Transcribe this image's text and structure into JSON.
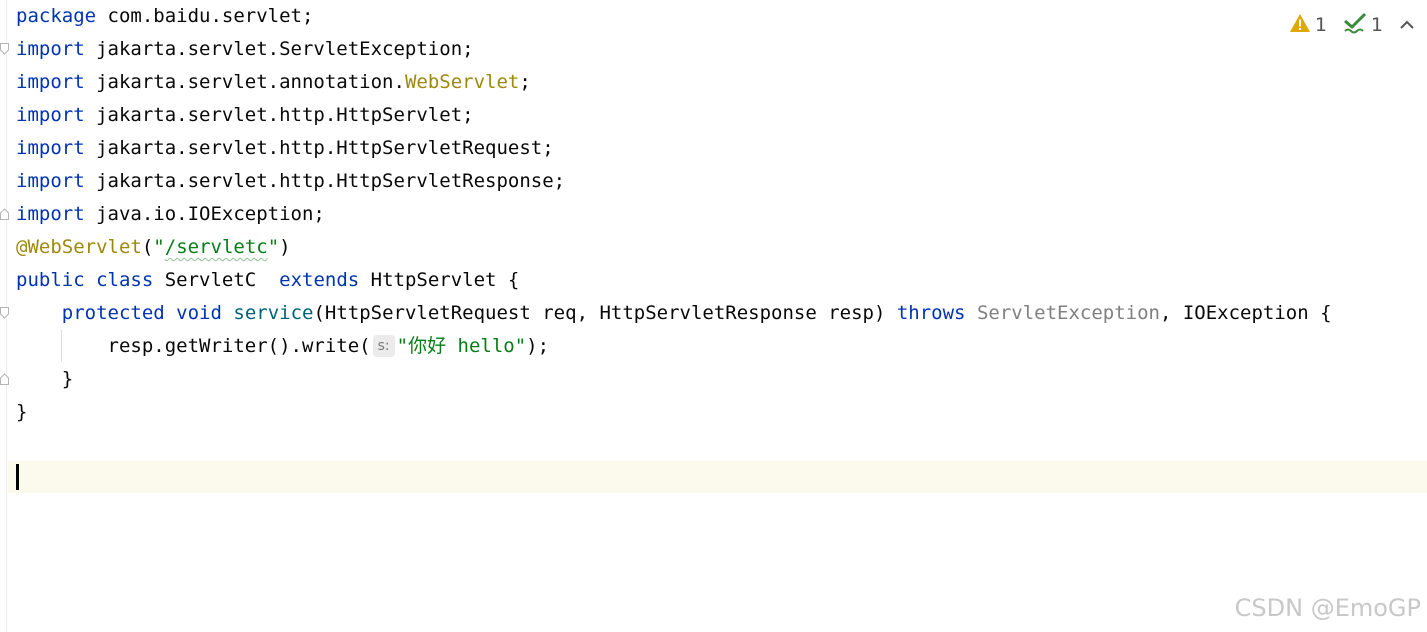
{
  "editor": {
    "lines": {
      "l1": {
        "kw": "package",
        "rest": " com.baidu.servlet;"
      },
      "l2": {
        "kw": "import",
        "rest": " jakarta.servlet.ServletException;"
      },
      "l3": {
        "kw": "import",
        "rest": " jakarta.servlet.annotation.",
        "ann": "WebServlet",
        "end": ";"
      },
      "l4": {
        "kw": "import",
        "rest": " jakarta.servlet.http.HttpServlet;"
      },
      "l5": {
        "kw": "import",
        "rest": " jakarta.servlet.http.HttpServletRequest;"
      },
      "l6": {
        "kw": "import",
        "rest": " jakarta.servlet.http.HttpServletResponse;"
      },
      "l7": {
        "kw": "import",
        "rest": " java.io.IOException;"
      },
      "l8": {
        "ann": "@WebServlet",
        "open": "(",
        "str_q1": "\"",
        "str_val": "/servletc",
        "str_q2": "\"",
        "close": ")"
      },
      "l9": {
        "kw1": "public",
        "kw2": "class",
        "name": " ServletC  ",
        "kw3": "extends",
        "rest": " HttpServlet {"
      },
      "l10": {
        "indent": "    ",
        "kw1": "protected",
        "kw2": "void",
        "fn": "service",
        "params": "(HttpServletRequest req, HttpServletResponse resp) ",
        "kw3": "throws",
        "muted": " ServletException",
        "rest": ", IOException {"
      },
      "l11": {
        "indent": "        ",
        "call": "resp.getWriter().write(",
        "hint": "s:",
        "str": "\"你好 hello\"",
        "end": ");"
      },
      "l12": {
        "text": "    }"
      },
      "l13": {
        "text": "}"
      }
    }
  },
  "inspection": {
    "warnings": "1",
    "weak_warnings": "1",
    "warning_color": "#e0a800",
    "ok_color": "#3b8a3b"
  },
  "watermark": "CSDN @EmoGP"
}
